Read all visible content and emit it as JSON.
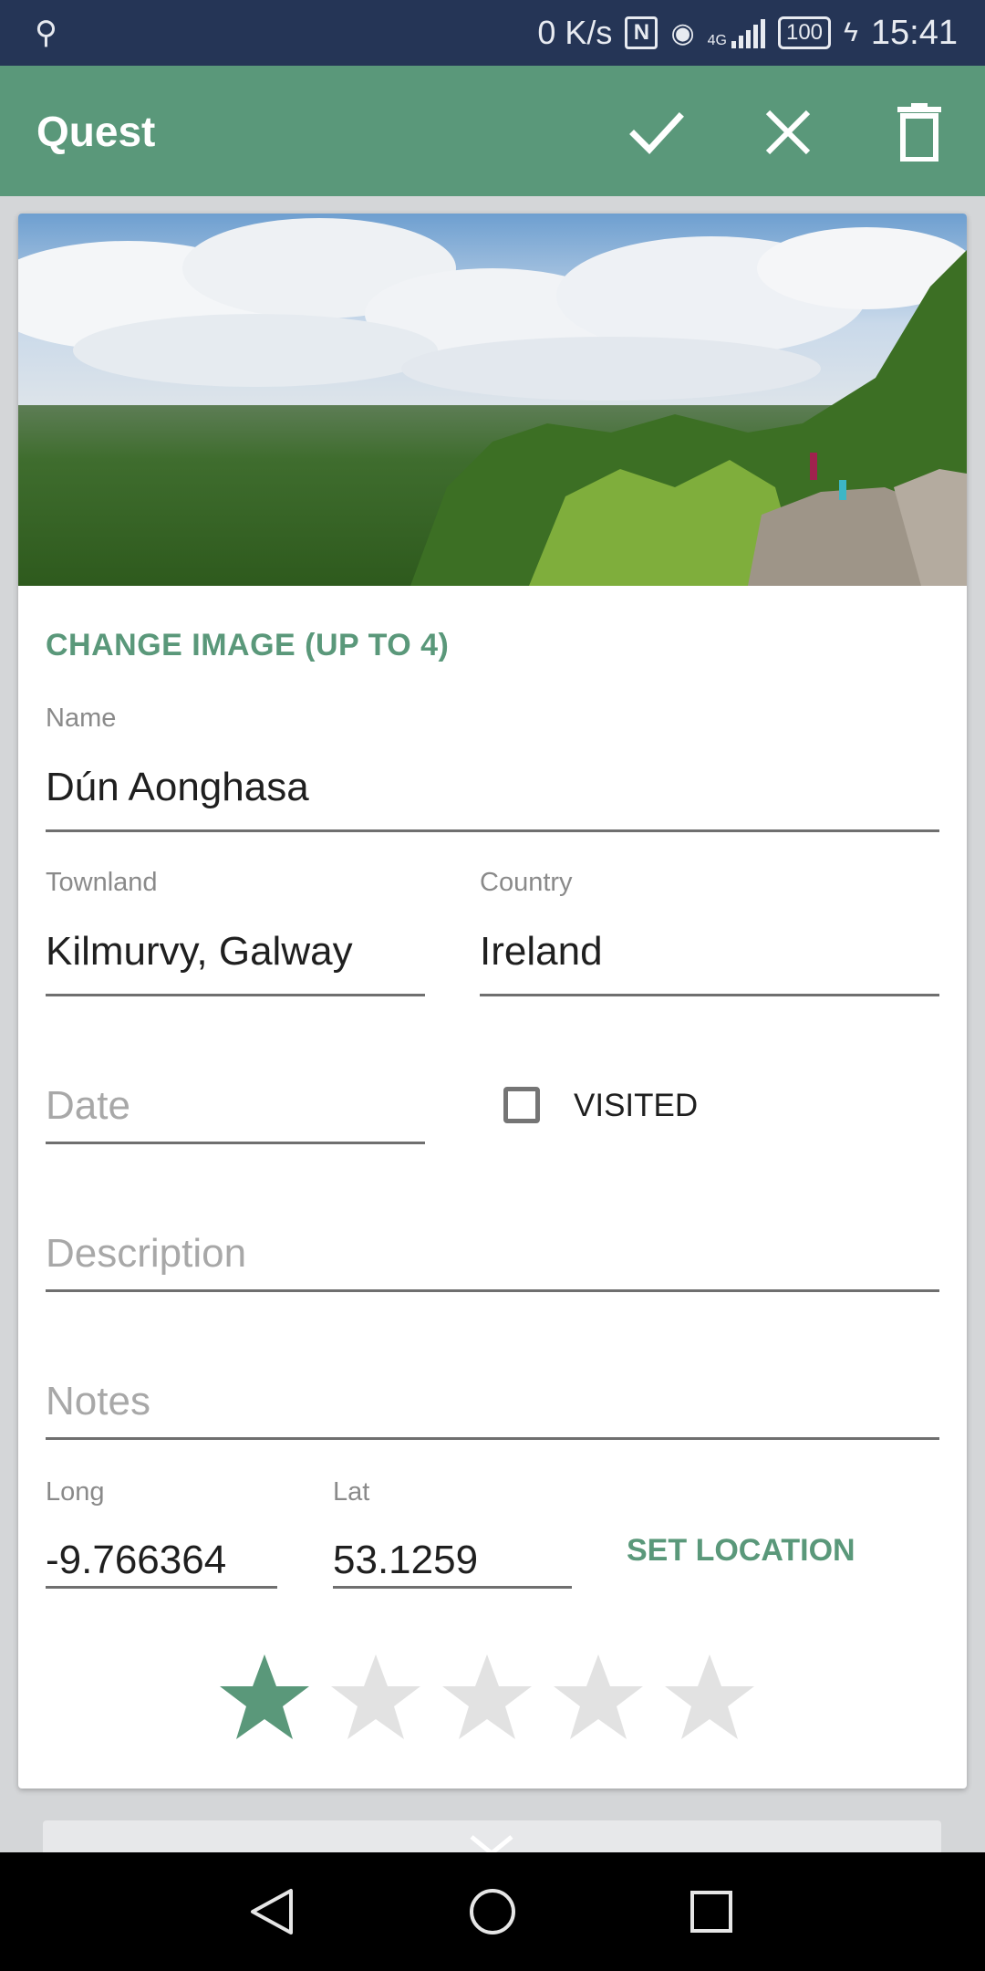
{
  "status_bar": {
    "usb_icon": "usb-icon",
    "network_speed": "0 K/s",
    "network_type": "4G",
    "battery": "100",
    "time": "15:41"
  },
  "app_bar": {
    "title": "Quest",
    "actions": [
      "check-icon",
      "close-icon",
      "trash-icon"
    ],
    "color": "#5a987a"
  },
  "form": {
    "change_image_label": "CHANGE IMAGE (UP TO 4)",
    "name": {
      "label": "Name",
      "value": "Dún Aonghasa"
    },
    "townland": {
      "label": "Townland",
      "value": "Kilmurvy, Galway"
    },
    "country": {
      "label": "Country",
      "value": "Ireland"
    },
    "date": {
      "placeholder": "Date"
    },
    "visited": {
      "label": "VISITED",
      "checked": false
    },
    "description": {
      "placeholder": "Description"
    },
    "notes": {
      "placeholder": "Notes"
    },
    "long": {
      "label": "Long",
      "value": "-9.766364"
    },
    "lat": {
      "label": "Lat",
      "value": "53.1259"
    },
    "set_location_label": "SET LOCATION",
    "rating": {
      "value": 1,
      "max": 5,
      "filled_color": "#5a987a",
      "empty_color": "#e2e2e2"
    }
  },
  "nav_bar": {
    "buttons": [
      "back-triangle-icon",
      "home-circle-icon",
      "recents-square-icon"
    ]
  }
}
